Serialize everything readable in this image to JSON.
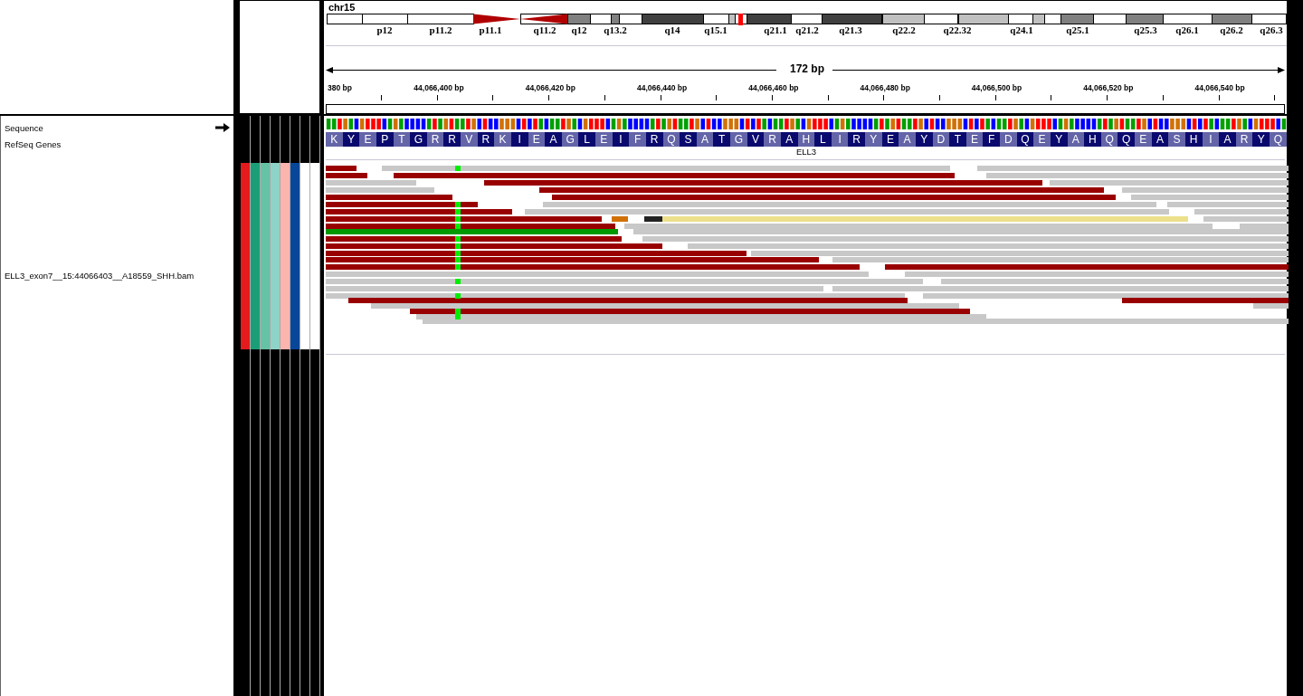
{
  "ideogram": {
    "chromosome": "chr15",
    "band_labels": [
      "p12",
      "p11.2",
      "p11.1",
      "q11.2",
      "q12",
      "q13.2",
      "q14",
      "q15.1",
      "q21.1",
      "q21.2",
      "q21.3",
      "q22.2",
      "q22.32",
      "q24.1",
      "q25.1",
      "q25.3",
      "q26.1",
      "q26.2",
      "q26.3"
    ]
  },
  "ruler": {
    "span": "172 bp",
    "tick_labels": [
      "380 bp",
      "44,066,400 bp",
      "44,066,420 bp",
      "44,066,440 bp",
      "44,066,460 bp",
      "44,066,480 bp",
      "44,066,500 bp",
      "44,066,520 bp",
      "44,066,540 bp"
    ]
  },
  "tracks": [
    {
      "name": "Sequence",
      "kind": "sequence"
    },
    {
      "name": "RefSeq Genes",
      "kind": "gene"
    },
    {
      "name": "ELL3_exon7__15:44066403__A18559_SHH.bam",
      "kind": "alignment"
    }
  ],
  "attributes": [
    {
      "color": "#e41a1c"
    },
    {
      "color": "#1b9e77"
    },
    {
      "color": "#66c2a5"
    },
    {
      "color": "#8dd3c7"
    },
    {
      "color": "#fbb4ae"
    },
    {
      "color": "#08469a"
    },
    {
      "color": "#ffffff"
    },
    {
      "color": "#ffffff"
    }
  ],
  "gene": {
    "name": "ELL3",
    "amino_acids": [
      "K",
      "Y",
      "E",
      "P",
      "T",
      "G",
      "R",
      "R",
      "V",
      "R",
      "K",
      "I",
      "E",
      "A",
      "G",
      "L",
      "E",
      "I",
      "F",
      "R",
      "Q",
      "S",
      "A",
      "T",
      "G",
      "V",
      "R",
      "A",
      "H",
      "L",
      "I",
      "R",
      "Y",
      "E",
      "A",
      "Y",
      "D",
      "T",
      "E",
      "F",
      "D",
      "Q",
      "E",
      "Y",
      "A",
      "H",
      "Q",
      "Q",
      "E",
      "A",
      "S",
      "H",
      "I",
      "A",
      "R",
      "Y",
      "Q"
    ]
  }
}
